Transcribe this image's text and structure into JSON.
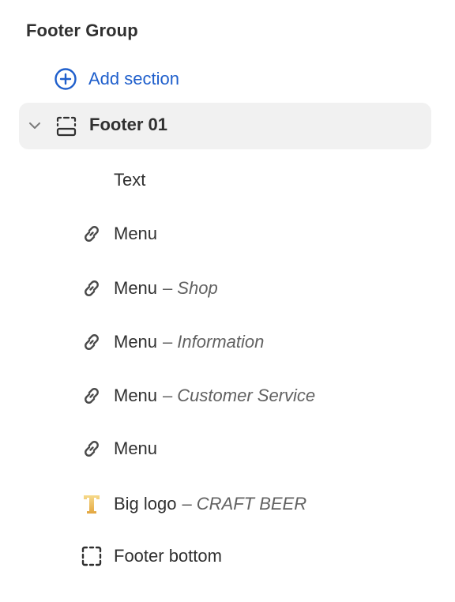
{
  "group": {
    "title": "Footer Group"
  },
  "add_section": {
    "label": "Add section",
    "icon": "plus-circle-icon",
    "color": "#1f5fcc"
  },
  "section": {
    "label": "Footer 01",
    "expanded": true,
    "icon": "footer-section-icon"
  },
  "blocks": [
    {
      "name": "Text",
      "subtitle": "",
      "icon": ""
    },
    {
      "name": "Menu",
      "subtitle": "",
      "icon": "link-icon"
    },
    {
      "name": "Menu",
      "subtitle": "Shop",
      "icon": "link-icon"
    },
    {
      "name": "Menu",
      "subtitle": "Information",
      "icon": "link-icon"
    },
    {
      "name": "Menu",
      "subtitle": "Customer Service",
      "icon": "link-icon"
    },
    {
      "name": "Menu",
      "subtitle": "",
      "icon": "link-icon"
    },
    {
      "name": "Big logo",
      "subtitle": "CRAFT BEER",
      "icon": "logo-image-icon"
    },
    {
      "name": "Footer bottom",
      "subtitle": "",
      "icon": "dashed-frame-icon"
    }
  ],
  "dash": "–"
}
